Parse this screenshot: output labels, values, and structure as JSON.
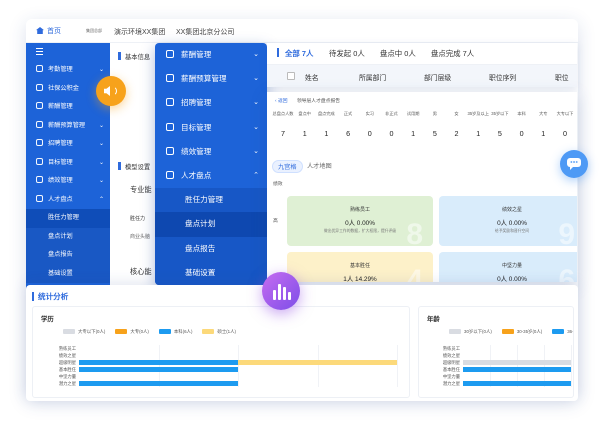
{
  "topbar": {
    "home": "首页",
    "small_crumb": "集团总部",
    "crumb1": "演示环境XX集团",
    "crumb2": "XX集团北京分公司"
  },
  "side1": {
    "items": [
      {
        "label": "考勤管理",
        "arrow": "⌄"
      },
      {
        "label": "社保公积金",
        "arrow": ""
      },
      {
        "label": "薪酬管理",
        "arrow": ""
      },
      {
        "label": "薪酬预算管理",
        "arrow": "⌄"
      },
      {
        "label": "招聘管理",
        "arrow": "⌄"
      },
      {
        "label": "目标管理",
        "arrow": "⌄"
      },
      {
        "label": "绩效管理",
        "arrow": "⌄"
      },
      {
        "label": "人才盘点",
        "arrow": "⌃"
      }
    ],
    "subs": [
      "胜任力管理",
      "盘点计划",
      "盘点报告",
      "基础设置"
    ]
  },
  "back_labels": {
    "basic_info": "基本信息",
    "model_settings": "模型设置",
    "professional": "专业能",
    "competency": "胜任力",
    "business_sense": "商业头脑",
    "core_ability": "核心能"
  },
  "panelA": {
    "items": [
      {
        "label": "薪酬管理",
        "arrow": "⌄"
      },
      {
        "label": "薪酬预算管理",
        "arrow": "⌄"
      },
      {
        "label": "招聘管理",
        "arrow": "⌄"
      },
      {
        "label": "目标管理",
        "arrow": "⌄"
      },
      {
        "label": "绩效管理",
        "arrow": "⌄"
      },
      {
        "label": "人才盘点",
        "arrow": "⌃"
      }
    ],
    "subs": [
      "胜任力管理",
      "盘点计划",
      "盘点报告",
      "基础设置"
    ]
  },
  "panelB": {
    "tabs": [
      "全部 7人",
      "待发起 0人",
      "盘点中 0人",
      "盘点完成 7人"
    ],
    "cols": [
      "姓名",
      "所属部门",
      "部门层级",
      "职位序列",
      "职位"
    ]
  },
  "panelC": {
    "back": "返回",
    "title": "领导层人才盘点报告",
    "stats_headers": [
      "总盘点人数",
      "盘点中",
      "盘点完成",
      "正式",
      "实习",
      "非正式",
      "试用期",
      "男",
      "女",
      "35岁及以上",
      "35岁以下",
      "本科",
      "大专",
      "大专以下"
    ],
    "stats_values": [
      "7",
      "1",
      "1",
      "6",
      "0",
      "0",
      "1",
      "5",
      "2",
      "1",
      "5",
      "0",
      "1",
      "0"
    ],
    "tabs": [
      "九宫格",
      "人才地图"
    ],
    "perf": "绩效",
    "high": "高",
    "boxes": [
      {
        "title": "熟练员工",
        "value": "0人   0.00%",
        "desc": "做出优异工作的数据，扩大权限，提升评级"
      },
      {
        "title": "绩效之星",
        "value": "0人   0.00%",
        "desc": "给予奖励和晋升空间"
      },
      {
        "title": "基本胜任",
        "value": "1人   14.29%",
        "desc": ""
      },
      {
        "title": "中坚力量",
        "value": "0人   0.00%",
        "desc": ""
      }
    ]
  },
  "stats": {
    "title": "统计分析",
    "edu": {
      "title": "学历",
      "legend": [
        "大专以下(0人)",
        "大专(0人)",
        "本科(6人)",
        "硕士(1人)"
      ],
      "colors": [
        "#d9dce2",
        "#f7a21b",
        "#1d9bf0",
        "#fcd97a"
      ],
      "categories": [
        "熟练员工",
        "绩效之星",
        "超级明星",
        "基本胜任",
        "中坚力量",
        "潜力之星"
      ],
      "values": [
        [
          0,
          0,
          0,
          0
        ],
        [
          0,
          0,
          0,
          0
        ],
        [
          0,
          0,
          1,
          1
        ],
        [
          0,
          0,
          1,
          0
        ],
        [
          0,
          0,
          0,
          0
        ],
        [
          0,
          0,
          1,
          0
        ]
      ]
    },
    "age": {
      "title": "年龄",
      "legend": [
        "30岁以下(0人)",
        "30-35岁(0人)",
        "36-40岁(0人)"
      ],
      "colors": [
        "#d9dce2",
        "#f7a21b",
        "#1d9bf0"
      ],
      "categories": [
        "熟练员工",
        "绩效之星",
        "超级明星",
        "基本胜任",
        "中坚力量",
        "潜力之星"
      ],
      "values": [
        [
          0,
          0,
          0
        ],
        [
          0,
          0,
          0
        ],
        [
          1,
          0,
          0
        ],
        [
          0,
          0,
          1
        ],
        [
          0,
          0,
          0
        ],
        [
          0,
          0,
          1
        ]
      ]
    }
  },
  "icons": {
    "speaker": "speaker-icon",
    "chat": "chat-icon",
    "chart": "bar-chart-icon"
  }
}
